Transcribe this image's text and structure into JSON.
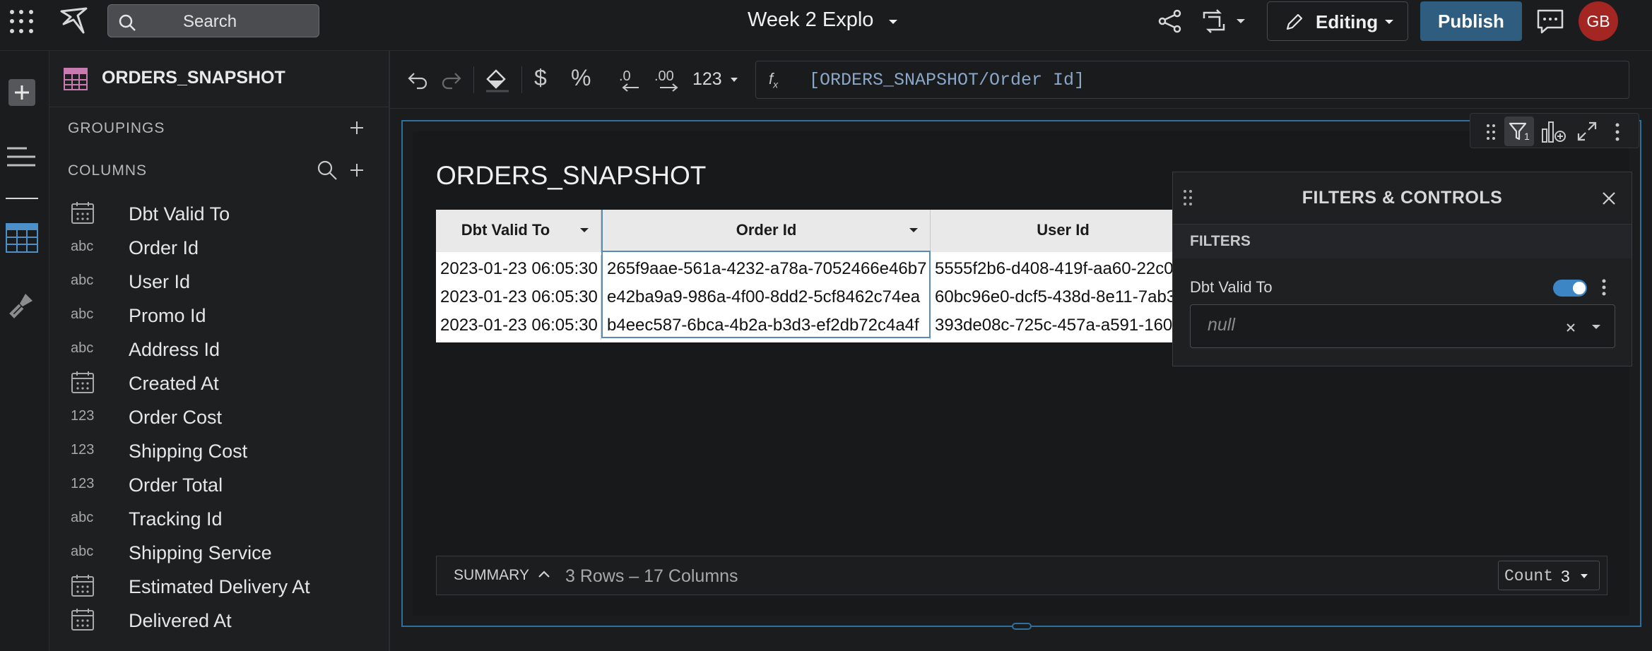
{
  "topbar": {
    "search_placeholder": "Search",
    "title": "Week 2 Explo",
    "editing_label": "Editing",
    "publish_label": "Publish",
    "avatar_initials": "GB"
  },
  "panel": {
    "table_name": "ORDERS_SNAPSHOT",
    "groupings_label": "GROUPINGS",
    "columns_label": "COLUMNS",
    "columns": [
      {
        "type": "date",
        "type_label": "",
        "name": "Dbt Valid To"
      },
      {
        "type": "text",
        "type_label": "abc",
        "name": "Order Id"
      },
      {
        "type": "text",
        "type_label": "abc",
        "name": "User Id"
      },
      {
        "type": "text",
        "type_label": "abc",
        "name": "Promo Id"
      },
      {
        "type": "text",
        "type_label": "abc",
        "name": "Address Id"
      },
      {
        "type": "date",
        "type_label": "",
        "name": "Created At"
      },
      {
        "type": "number",
        "type_label": "123",
        "name": "Order Cost"
      },
      {
        "type": "number",
        "type_label": "123",
        "name": "Shipping Cost"
      },
      {
        "type": "number",
        "type_label": "123",
        "name": "Order Total"
      },
      {
        "type": "text",
        "type_label": "abc",
        "name": "Tracking Id"
      },
      {
        "type": "text",
        "type_label": "abc",
        "name": "Shipping Service"
      },
      {
        "type": "date",
        "type_label": "",
        "name": "Estimated Delivery At"
      },
      {
        "type": "date",
        "type_label": "",
        "name": "Delivered At"
      }
    ]
  },
  "toolbar": {
    "format_label": "123",
    "formula": "[ORDERS_SNAPSHOT/Order Id]"
  },
  "element": {
    "title": "ORDERS_SNAPSHOT",
    "columns": [
      "Dbt Valid To",
      "Order Id",
      "User Id"
    ],
    "rows": [
      [
        "2023-01-23 06:05:30",
        "265f9aae-561a-4232-a78a-7052466e46b7",
        "5555f2b6-d408-419f-aa60-22c0"
      ],
      [
        "2023-01-23 06:05:30",
        "e42ba9a9-986a-4f00-8dd2-5cf8462c74ea",
        "60bc96e0-dcf5-438d-8e11-7ab3"
      ],
      [
        "2023-01-23 06:05:30",
        "b4eec587-6bca-4b2a-b3d3-ef2db72c4a4f",
        "393de08c-725c-457a-a591-160"
      ]
    ],
    "summary_label": "SUMMARY",
    "summary_text": "3 Rows – 17 Columns",
    "count_label": "Count",
    "count_value": "3"
  },
  "filters": {
    "title": "FILTERS & CONTROLS",
    "section": "FILTERS",
    "filter_name": "Dbt Valid To",
    "filter_value": "null",
    "filter_enabled": true,
    "badge": "1"
  },
  "colors": {
    "accent": "#2f5d80",
    "selection_border": "#2e6f9d",
    "avatar": "#a32622",
    "toggle": "#3d86c6"
  }
}
